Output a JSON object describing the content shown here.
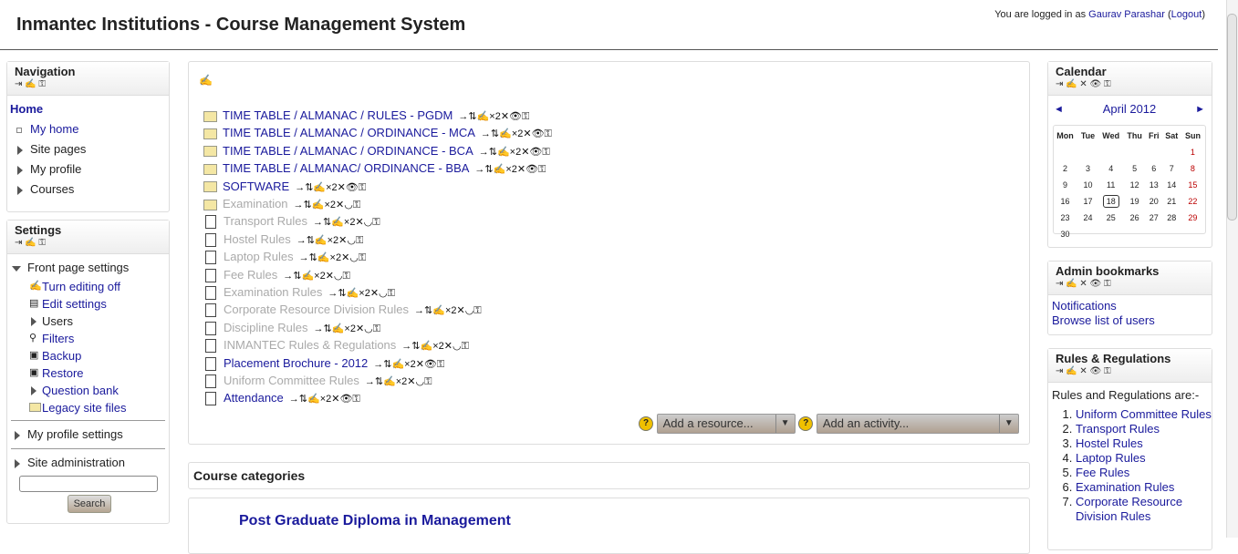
{
  "header": {
    "title": "Inmantec Institutions - Course Management System",
    "login_prefix": "You are logged in as",
    "user": "Gaurav Parashar",
    "logout": "Logout"
  },
  "block_ctrls": {
    "nav": "⇥ ✍ ⚿",
    "cal": "⇥ ✍ ✕ 👁 ⚿"
  },
  "navigation": {
    "title": "Navigation",
    "home": "Home",
    "items": [
      "My home",
      "Site pages",
      "My profile",
      "Courses"
    ]
  },
  "settings": {
    "title": "Settings",
    "front": "Front page settings",
    "items": [
      "Turn editing off",
      "Edit settings",
      "Users",
      "Filters",
      "Backup",
      "Restore",
      "Question bank",
      "Legacy site files"
    ],
    "profile": "My profile settings",
    "admin": "Site administration",
    "search_button": "Search"
  },
  "main": {
    "edit_icon": "✍",
    "resources": [
      {
        "label": "TIME TABLE / ALMANAC / RULES - PGDM",
        "type": "folder",
        "visible": true
      },
      {
        "label": "TIME TABLE / ALMANAC / ORDINANCE - MCA",
        "type": "folder",
        "visible": true
      },
      {
        "label": "TIME TABLE / ALMANAC / ORDINANCE - BCA",
        "type": "folder",
        "visible": true
      },
      {
        "label": "TIME TABLE / ALMANAC/ ORDINANCE - BBA",
        "type": "folder",
        "visible": true
      },
      {
        "label": "SOFTWARE",
        "type": "folder",
        "visible": true
      },
      {
        "label": "Examination",
        "type": "folder",
        "visible": false
      },
      {
        "label": "Transport Rules",
        "type": "doc",
        "visible": false
      },
      {
        "label": "Hostel Rules",
        "type": "doc",
        "visible": false
      },
      {
        "label": "Laptop Rules",
        "type": "doc",
        "visible": false
      },
      {
        "label": "Fee Rules",
        "type": "doc",
        "visible": false
      },
      {
        "label": "Examination Rules",
        "type": "doc",
        "visible": false
      },
      {
        "label": "Corporate Resource Division Rules",
        "type": "doc",
        "visible": false
      },
      {
        "label": "Discipline Rules",
        "type": "doc",
        "visible": false
      },
      {
        "label": "INMANTEC Rules & Regulations",
        "type": "doc",
        "visible": false
      },
      {
        "label": "Placement Brochure - 2012",
        "type": "doc",
        "visible": true
      },
      {
        "label": "Uniform Committee Rules",
        "type": "doc",
        "visible": false
      },
      {
        "label": "Attendance",
        "type": "doc",
        "visible": true
      }
    ],
    "ctrls_visible": "→⇅✍×2✕👁⚿",
    "ctrls_hidden": "→⇅✍×2✕◡⚿",
    "add_resource": "Add a resource...",
    "add_activity": "Add an activity...",
    "help": "?"
  },
  "categories": {
    "title": "Course categories",
    "first": "Post Graduate Diploma in Management"
  },
  "calendar": {
    "title": "Calendar",
    "month": "April 2012",
    "prev": "◄",
    "next": "►",
    "days": [
      "Mon",
      "Tue",
      "Wed",
      "Thu",
      "Fri",
      "Sat",
      "Sun"
    ],
    "weeks": [
      [
        "",
        "",
        "",
        "",
        "",
        "",
        "1"
      ],
      [
        "2",
        "3",
        "4",
        "5",
        "6",
        "7",
        "8"
      ],
      [
        "9",
        "10",
        "11",
        "12",
        "13",
        "14",
        "15"
      ],
      [
        "16",
        "17",
        "18",
        "19",
        "20",
        "21",
        "22"
      ],
      [
        "23",
        "24",
        "25",
        "26",
        "27",
        "28",
        "29"
      ],
      [
        "30",
        "",
        "",
        "",
        "",
        "",
        ""
      ]
    ],
    "today": "18"
  },
  "admin_bookmarks": {
    "title": "Admin bookmarks",
    "links": [
      "Notifications",
      "Browse list of users"
    ]
  },
  "rules": {
    "title": "Rules & Regulations",
    "intro": "Rules and Regulations are:-",
    "items": [
      "Uniform Committee Rules",
      "Transport Rules",
      "Hostel Rules",
      "Laptop Rules",
      "Fee Rules",
      "Examination Rules",
      "Corporate Resource Division Rules"
    ]
  }
}
